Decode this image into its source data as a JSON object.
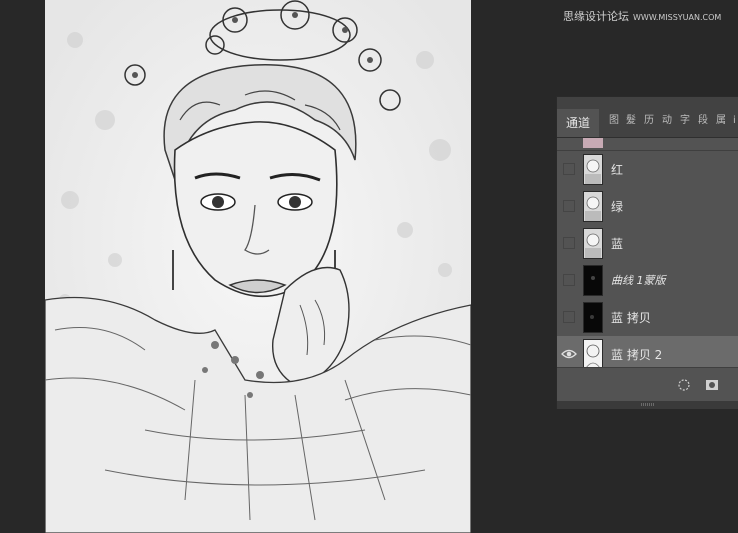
{
  "watermark": {
    "title": "思缘设计论坛",
    "site": "WWW.MISSYUAN.COM"
  },
  "channels_panel": {
    "active_tab": "通道",
    "other_tabs": [
      "图",
      "髮",
      "历",
      "动",
      "字",
      "段",
      "属",
      "i"
    ],
    "channels": [
      {
        "label": "红",
        "visible": false,
        "thumbnail": "color-portrait"
      },
      {
        "label": "绿",
        "visible": false,
        "thumbnail": "color-portrait"
      },
      {
        "label": "蓝",
        "visible": false,
        "thumbnail": "color-portrait"
      },
      {
        "label": "曲线 1蒙版",
        "visible": false,
        "thumbnail": "dark-mask"
      },
      {
        "label": "蓝 拷贝",
        "visible": false,
        "thumbnail": "dark-mask"
      },
      {
        "label": "蓝 拷贝 2",
        "visible": true,
        "selected": true,
        "thumbnail": "sketch"
      }
    ],
    "footer_icons": [
      "selection-icon",
      "mask-icon"
    ]
  },
  "colors": {
    "workspace_bg": "#282828",
    "panel_bg": "#535353",
    "selected_row": "#6b6b6b"
  }
}
